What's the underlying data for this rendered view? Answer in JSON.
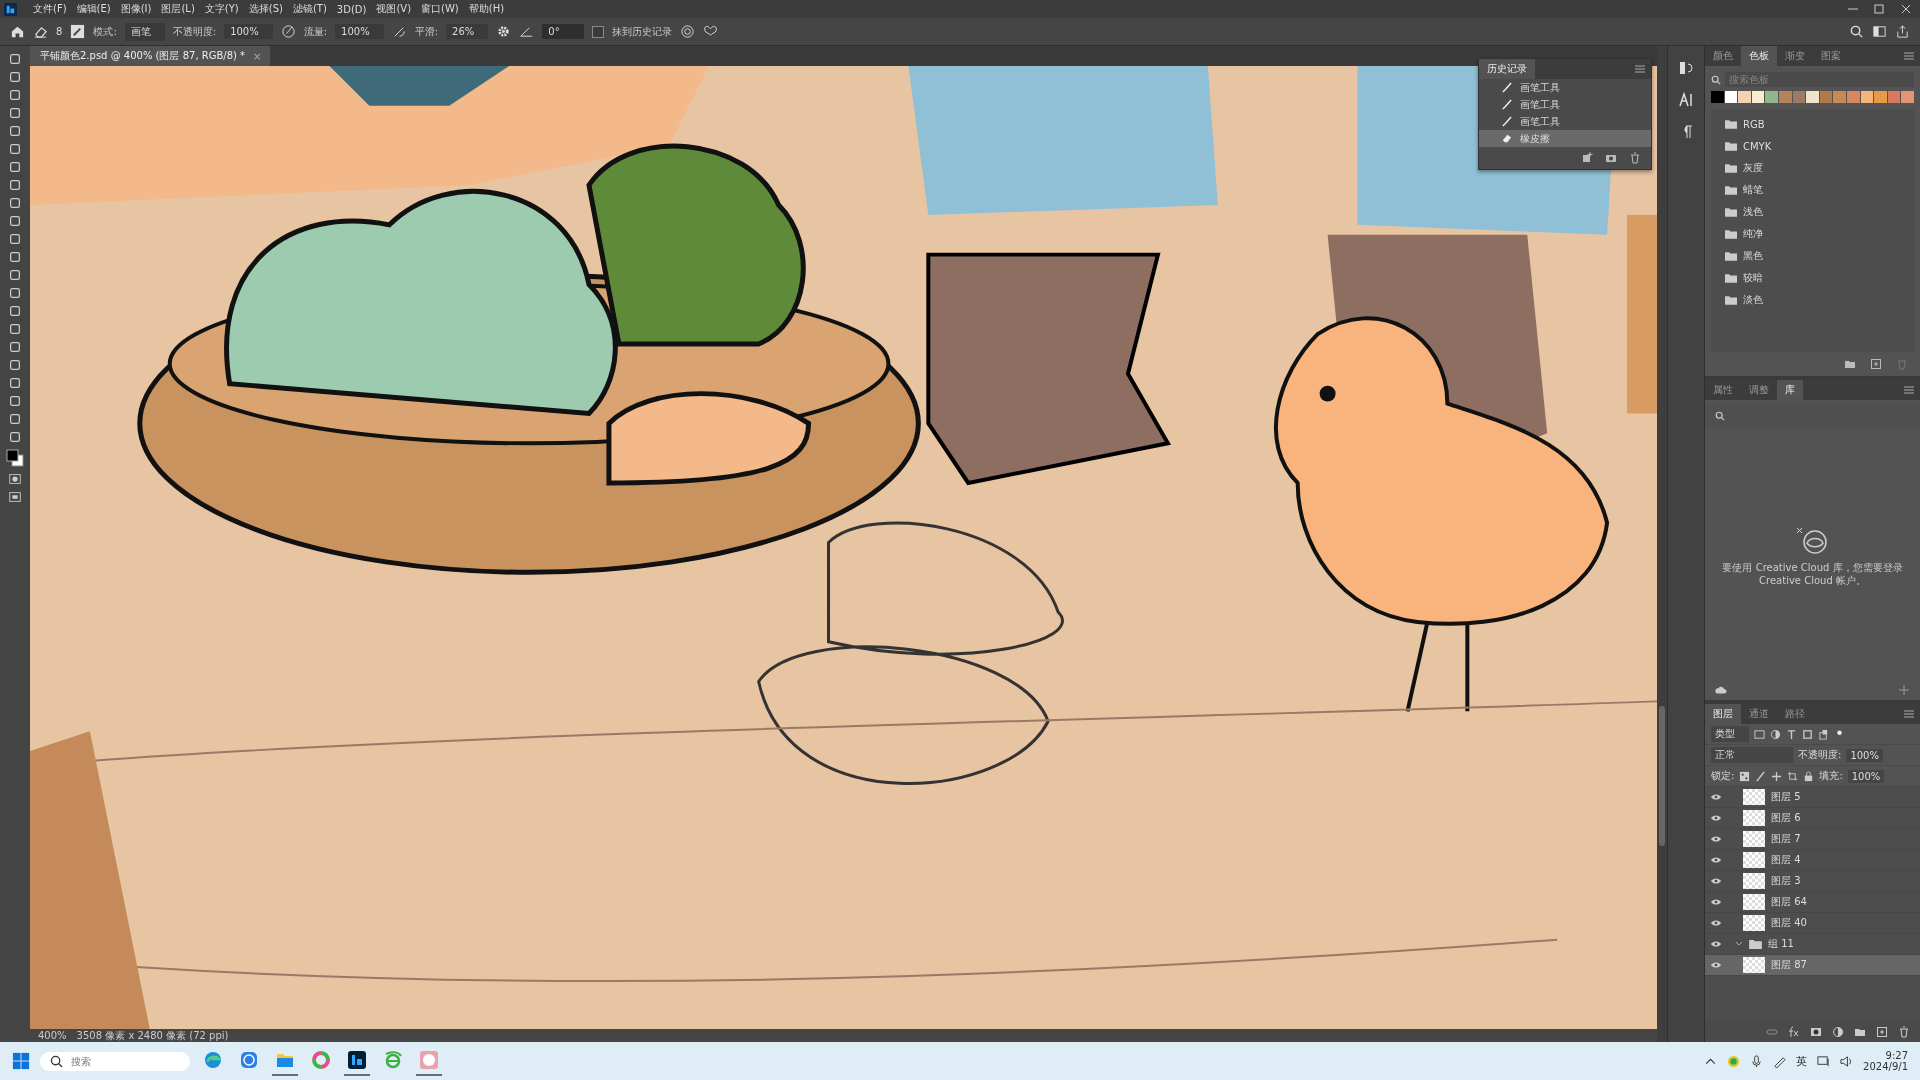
{
  "menu": [
    "文件(F)",
    "编辑(E)",
    "图像(I)",
    "图层(L)",
    "文字(Y)",
    "选择(S)",
    "滤镜(T)",
    "3D(D)",
    "视图(V)",
    "窗口(W)",
    "帮助(H)"
  ],
  "options": {
    "brush_size": "8",
    "mode_label": "模式:",
    "mode": "画笔",
    "opacity_label": "不透明度:",
    "opacity": "100%",
    "flow_label": "流量:",
    "flow": "100%",
    "smooth_label": "平滑:",
    "smooth": "26%",
    "angle": "0°",
    "erase_history": {
      "label": "抹到历史记录",
      "checked": false
    }
  },
  "document_tab": {
    "title": "平铺颜色2.psd @ 400% (图层 87, RGB/8) *",
    "close": "×"
  },
  "history": {
    "title": "历史记录",
    "items": [
      {
        "kind": "brush",
        "label": "画笔工具",
        "selected": false
      },
      {
        "kind": "brush",
        "label": "画笔工具",
        "selected": false
      },
      {
        "kind": "brush",
        "label": "画笔工具",
        "selected": false
      },
      {
        "kind": "eraser",
        "label": "橡皮擦",
        "selected": true
      }
    ]
  },
  "swatches_panel": {
    "tabs": [
      {
        "label": "颜色",
        "selected": false
      },
      {
        "label": "色板",
        "selected": true
      },
      {
        "label": "渐变",
        "selected": false
      },
      {
        "label": "图案",
        "selected": false
      }
    ],
    "search": {
      "placeholder": "搜索色板"
    },
    "swatches": [
      {
        "color": "#000000"
      },
      {
        "color": "#ffffff"
      },
      {
        "color": "#f3d2b0"
      },
      {
        "color": "#f8ecd0"
      },
      {
        "color": "#8fb88a"
      },
      {
        "color": "#b5835a"
      },
      {
        "color": "#9c7a66"
      },
      {
        "color": "#f2e2cc"
      },
      {
        "color": "#b07a4a"
      },
      {
        "color": "#c58a56"
      },
      {
        "color": "#d8865e"
      },
      {
        "color": "#f5b47a"
      },
      {
        "color": "#e89a4a"
      },
      {
        "color": "#d87b5c"
      },
      {
        "color": "#e29474"
      }
    ],
    "groups": [
      "RGB",
      "CMYK",
      "灰度",
      "蜡笔",
      "浅色",
      "纯净",
      "黑色",
      "较暗",
      "淡色"
    ]
  },
  "library_panel": {
    "tabs": [
      {
        "label": "属性",
        "selected": false
      },
      {
        "label": "调整",
        "selected": false
      },
      {
        "label": "库",
        "selected": true
      }
    ],
    "message": "要使用 Creative Cloud 库，您需要登录 Creative Cloud 帐户。"
  },
  "layers_panel": {
    "tabs": [
      {
        "label": "图层",
        "selected": true
      },
      {
        "label": "通道",
        "selected": false
      },
      {
        "label": "路径",
        "selected": false
      }
    ],
    "filter": "类型",
    "blend_mode": "正常",
    "opacity_label": "不透明度:",
    "opacity": "100%",
    "lock_label": "锁定:",
    "fill_label": "填充:",
    "fill": "100%",
    "layers": [
      {
        "kind": "layer",
        "name": "图层 5",
        "visible": true,
        "selected": false
      },
      {
        "kind": "layer",
        "name": "图层 6",
        "visible": true,
        "selected": false
      },
      {
        "kind": "layer",
        "name": "图层 7",
        "visible": true,
        "selected": false
      },
      {
        "kind": "layer",
        "name": "图层 4",
        "visible": true,
        "selected": false
      },
      {
        "kind": "layer",
        "name": "图层 3",
        "visible": true,
        "selected": false
      },
      {
        "kind": "layer",
        "name": "图层 64",
        "visible": true,
        "selected": false
      },
      {
        "kind": "layer",
        "name": "图层 40",
        "visible": true,
        "selected": false
      },
      {
        "kind": "group",
        "name": "组 11",
        "visible": true,
        "selected": false,
        "expanded": true,
        "children": [
          {
            "kind": "layer",
            "name": "图层 87",
            "visible": true,
            "selected": true
          }
        ]
      }
    ]
  },
  "status_bar": {
    "zoom": "400%",
    "info": "3508 像素 x 2480 像素 (72 ppi)"
  },
  "taskbar": {
    "search": {
      "placeholder": "搜索"
    },
    "apps": [
      {
        "kind": "edge",
        "running": false
      },
      {
        "kind": "k",
        "running": false
      },
      {
        "kind": "folder",
        "running": true
      },
      {
        "kind": "colorwheel",
        "running": false
      },
      {
        "kind": "ps",
        "running": true
      },
      {
        "kind": "ie",
        "running": false
      },
      {
        "kind": "w",
        "running": true
      }
    ],
    "ime": "英",
    "time": "9:27",
    "date": "2024/9/1"
  }
}
